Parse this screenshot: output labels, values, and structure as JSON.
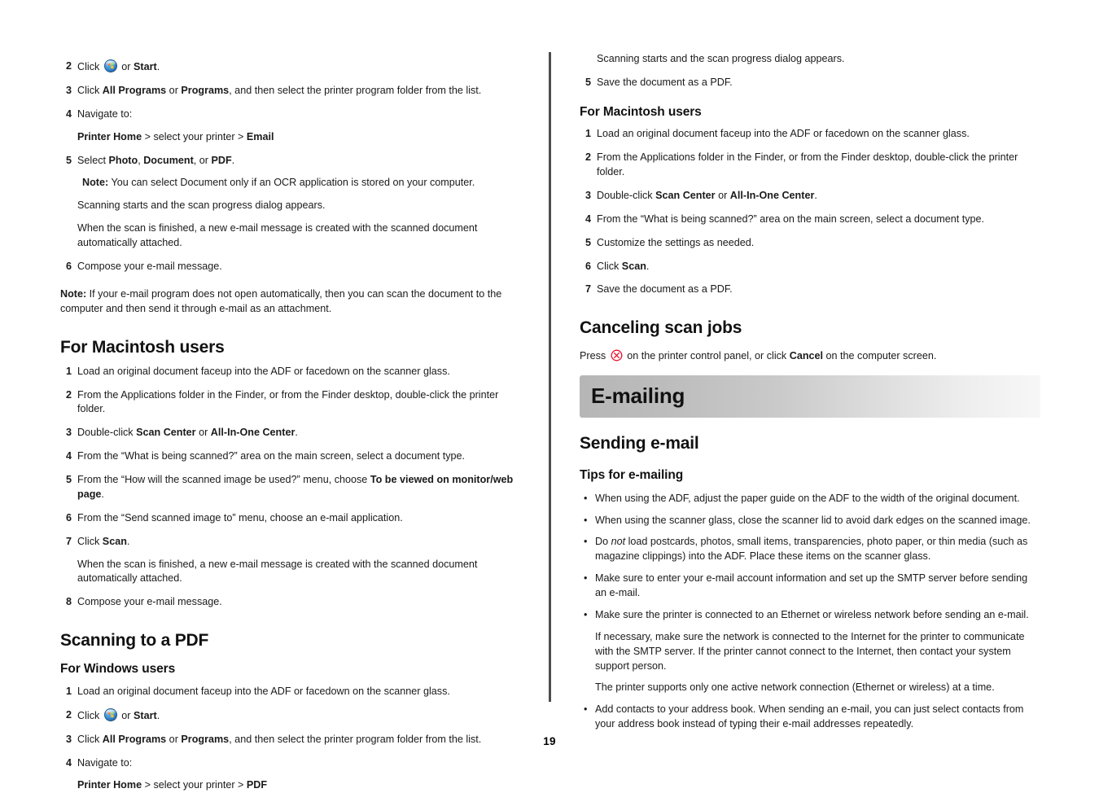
{
  "page": {
    "number": "19"
  },
  "icons": {
    "start_orb": "windows-start-orb-icon",
    "cancel": "cancel-x-icon"
  },
  "colors": {
    "banner_gradient_start": "#b6b6b6",
    "banner_gradient_end": "#f7f7f7",
    "divider": "#4d4d4d",
    "cancel_icon": "#e8112d",
    "text": "#1a1a1a"
  },
  "left_column": {
    "email_windows_steps": {
      "step2": {
        "num": "2",
        "pre": "Click ",
        "mid": " or ",
        "bold": "Start",
        "post": "."
      },
      "step3": {
        "num": "3",
        "pre": "Click ",
        "bold1": "All Programs",
        "mid": " or ",
        "bold2": "Programs",
        "post": ", and then select the printer program folder from the list."
      },
      "step4": {
        "num": "4",
        "text": "Navigate to:",
        "path_bold1": "Printer Home",
        "path_mid": " > select your printer > ",
        "path_bold2": "Email"
      },
      "step5": {
        "num": "5",
        "pre": "Select ",
        "bold1": "Photo",
        "sep1": ", ",
        "bold2": "Document",
        "sep2": ", or ",
        "bold3": "PDF",
        "post": ".",
        "note_label": "Note:",
        "note_text": " You can select Document only if an OCR application is stored on your computer.",
        "sub1": "Scanning starts and the scan progress dialog appears.",
        "sub2": "When the scan is finished, a new e-mail message is created with the scanned document automatically attached."
      },
      "step6": {
        "num": "6",
        "text": "Compose your e-mail message."
      }
    },
    "email_note": {
      "label": "Note:",
      "text": " If your e-mail program does not open automatically, then you can scan the document to the computer and then send it through e-mail as an attachment."
    },
    "mac_heading": "For Macintosh users",
    "email_mac_steps": {
      "step1": {
        "num": "1",
        "text": "Load an original document faceup into the ADF or facedown on the scanner glass."
      },
      "step2": {
        "num": "2",
        "text": "From the Applications folder in the Finder, or from the Finder desktop, double-click the printer folder."
      },
      "step3": {
        "num": "3",
        "pre": "Double-click ",
        "bold1": "Scan Center",
        "mid": " or ",
        "bold2": "All-In-One Center",
        "post": "."
      },
      "step4": {
        "num": "4",
        "text": "From the “What is being scanned?” area on the main screen, select a document type."
      },
      "step5": {
        "num": "5",
        "pre": "From the “How will the scanned image be used?” menu, choose ",
        "bold": "To be viewed on monitor/web page",
        "post": "."
      },
      "step6": {
        "num": "6",
        "text": "From the “Send scanned image to” menu, choose an e-mail application."
      },
      "step7": {
        "num": "7",
        "pre": "Click ",
        "bold": "Scan",
        "post": ".",
        "sub": "When the scan is finished, a new e-mail message is created with the scanned document automatically attached."
      },
      "step8": {
        "num": "8",
        "text": "Compose your e-mail message."
      }
    },
    "pdf_heading": "Scanning to a PDF",
    "pdf_windows_heading": "For Windows users",
    "pdf_windows_steps": {
      "step1": {
        "num": "1",
        "text": "Load an original document faceup into the ADF or facedown on the scanner glass."
      },
      "step2": {
        "num": "2",
        "pre": "Click ",
        "mid": " or ",
        "bold": "Start",
        "post": "."
      },
      "step3": {
        "num": "3",
        "pre": "Click ",
        "bold1": "All Programs",
        "mid": " or ",
        "bold2": "Programs",
        "post": ", and then select the printer program folder from the list."
      },
      "step4": {
        "num": "4",
        "text": "Navigate to:",
        "path_bold1": "Printer Home",
        "path_mid": " > select your printer > ",
        "path_bold2": "PDF"
      }
    }
  },
  "right_column": {
    "pdf_windows_cont": {
      "sub": "Scanning starts and the scan progress dialog appears.",
      "step5": {
        "num": "5",
        "text": "Save the document as a PDF."
      }
    },
    "pdf_mac_heading": "For Macintosh users",
    "pdf_mac_steps": {
      "step1": {
        "num": "1",
        "text": "Load an original document faceup into the ADF or facedown on the scanner glass."
      },
      "step2": {
        "num": "2",
        "text": "From the Applications folder in the Finder, or from the Finder desktop, double-click the printer folder."
      },
      "step3": {
        "num": "3",
        "pre": "Double-click ",
        "bold1": "Scan Center",
        "mid": " or ",
        "bold2": "All-In-One Center",
        "post": "."
      },
      "step4": {
        "num": "4",
        "text": "From the “What is being scanned?” area on the main screen, select a document type."
      },
      "step5": {
        "num": "5",
        "text": "Customize the settings as needed."
      },
      "step6": {
        "num": "6",
        "pre": "Click ",
        "bold": "Scan",
        "post": "."
      },
      "step7": {
        "num": "7",
        "text": "Save the document as a PDF."
      }
    },
    "cancel_heading": "Canceling scan jobs",
    "cancel_para": {
      "pre": "Press ",
      "mid": " on the printer control panel, or click ",
      "bold": "Cancel",
      "post": " on the computer screen."
    },
    "emailing_banner": "E-mailing",
    "sending_heading": "Sending e-mail",
    "tips_heading": "Tips for e-mailing",
    "tips": {
      "b1": "When using the ADF, adjust the paper guide on the ADF to the width of the original document.",
      "b2": "When using the scanner glass, close the scanner lid to avoid dark edges on the scanned image.",
      "b3_pre": "Do ",
      "b3_italic": "not",
      "b3_post": " load postcards, photos, small items, transparencies, photo paper, or thin media (such as magazine clippings) into the ADF. Place these items on the scanner glass.",
      "b4": "Make sure to enter your e-mail account information and set up the SMTP server before sending an e-mail.",
      "b5": "Make sure the printer is connected to an Ethernet or wireless network before sending an e-mail.",
      "b5_cont1": "If necessary, make sure the network is connected to the Internet for the printer to communicate with the SMTP server. If the printer cannot connect to the Internet, then contact your system support person.",
      "b5_cont2": "The printer supports only one active network connection (Ethernet or wireless) at a time.",
      "b6": "Add contacts to your address book. When sending an e-mail, you can just select contacts from your address book instead of typing their e-mail addresses repeatedly."
    }
  }
}
